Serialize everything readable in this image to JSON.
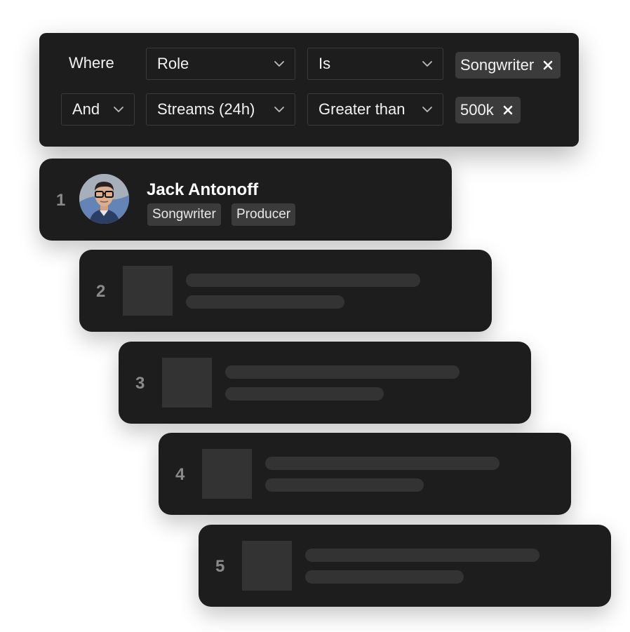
{
  "filter": {
    "row1": {
      "connector": "Where",
      "field": "Role",
      "operator": "Is",
      "value": "Songwriter"
    },
    "row2": {
      "connector": "And",
      "field": "Streams (24h)",
      "operator": "Greater than",
      "value": "500k"
    },
    "dropdown_icon": "chevron-down-icon",
    "remove_icon": "close-icon"
  },
  "results": [
    {
      "rank": "1",
      "name": "Jack Antonoff",
      "tags": [
        "Songwriter",
        "Producer"
      ]
    },
    {
      "rank": "2"
    },
    {
      "rank": "3"
    },
    {
      "rank": "4"
    },
    {
      "rank": "5"
    }
  ],
  "colors": {
    "card_bg": "#1d1d1d",
    "chip_bg": "#3b3b3b",
    "placeholder": "#333333",
    "rank_text": "#8a8a8a"
  }
}
